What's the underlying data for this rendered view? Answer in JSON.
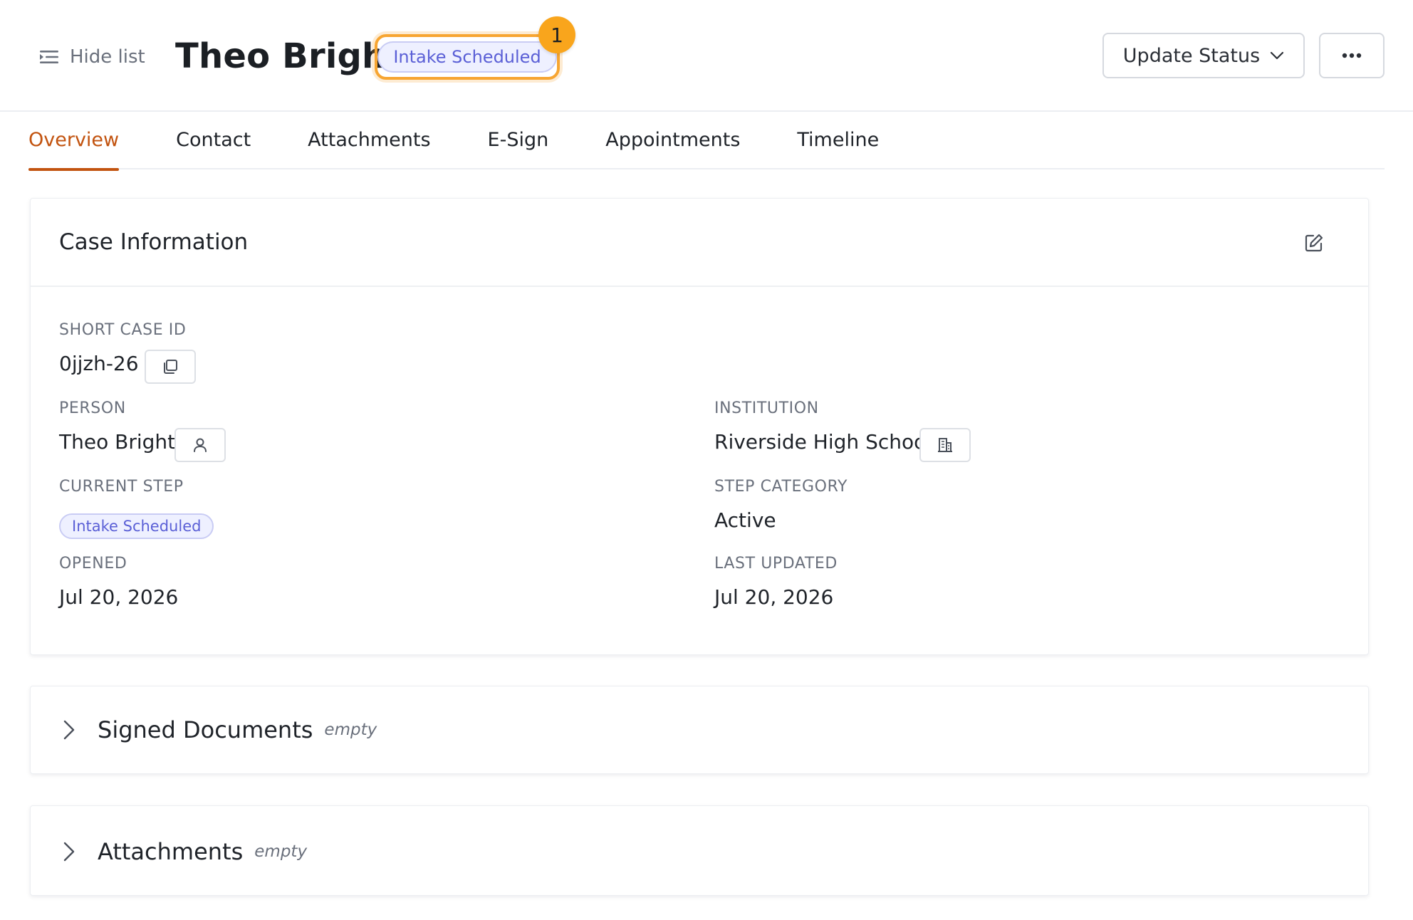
{
  "header": {
    "hide_list_label": "Hide list",
    "title": "Theo Bright",
    "status": "Intake Scheduled",
    "notification_count": "1",
    "update_status_label": "Update Status"
  },
  "tabs": [
    {
      "label": "Overview",
      "active": true
    },
    {
      "label": "Contact",
      "active": false
    },
    {
      "label": "Attachments",
      "active": false
    },
    {
      "label": "E-Sign",
      "active": false
    },
    {
      "label": "Appointments",
      "active": false
    },
    {
      "label": "Timeline",
      "active": false
    }
  ],
  "case_info": {
    "title": "Case Information",
    "short_case_id_label": "SHORT CASE ID",
    "short_case_id": "0jjzh-26",
    "person_label": "PERSON",
    "person": "Theo Bright",
    "institution_label": "INSTITUTION",
    "institution": "Riverside High School",
    "current_step_label": "CURRENT STEP",
    "current_step": "Intake Scheduled",
    "step_category_label": "STEP CATEGORY",
    "step_category": "Active",
    "opened_label": "OPENED",
    "opened": "Jul 20, 2026",
    "last_updated_label": "LAST UPDATED",
    "last_updated": "Jul 20, 2026"
  },
  "sections": {
    "signed_documents": {
      "title": "Signed Documents",
      "state": "empty"
    },
    "attachments": {
      "title": "Attachments",
      "state": "empty"
    }
  },
  "colors": {
    "accent": "#c2530f",
    "status_pill_text": "#5a5fd6",
    "status_pill_bg": "#eef0ff",
    "highlight": "#f7a531",
    "badge": "#f9a51c"
  },
  "icons": {
    "hide_list": "list-collapse-icon",
    "dropdown": "chevron-down-icon",
    "more": "more-horizontal-icon",
    "edit": "edit-icon",
    "copy": "copy-icon",
    "person": "user-icon",
    "institution": "building-icon",
    "expand": "chevron-right-icon"
  }
}
